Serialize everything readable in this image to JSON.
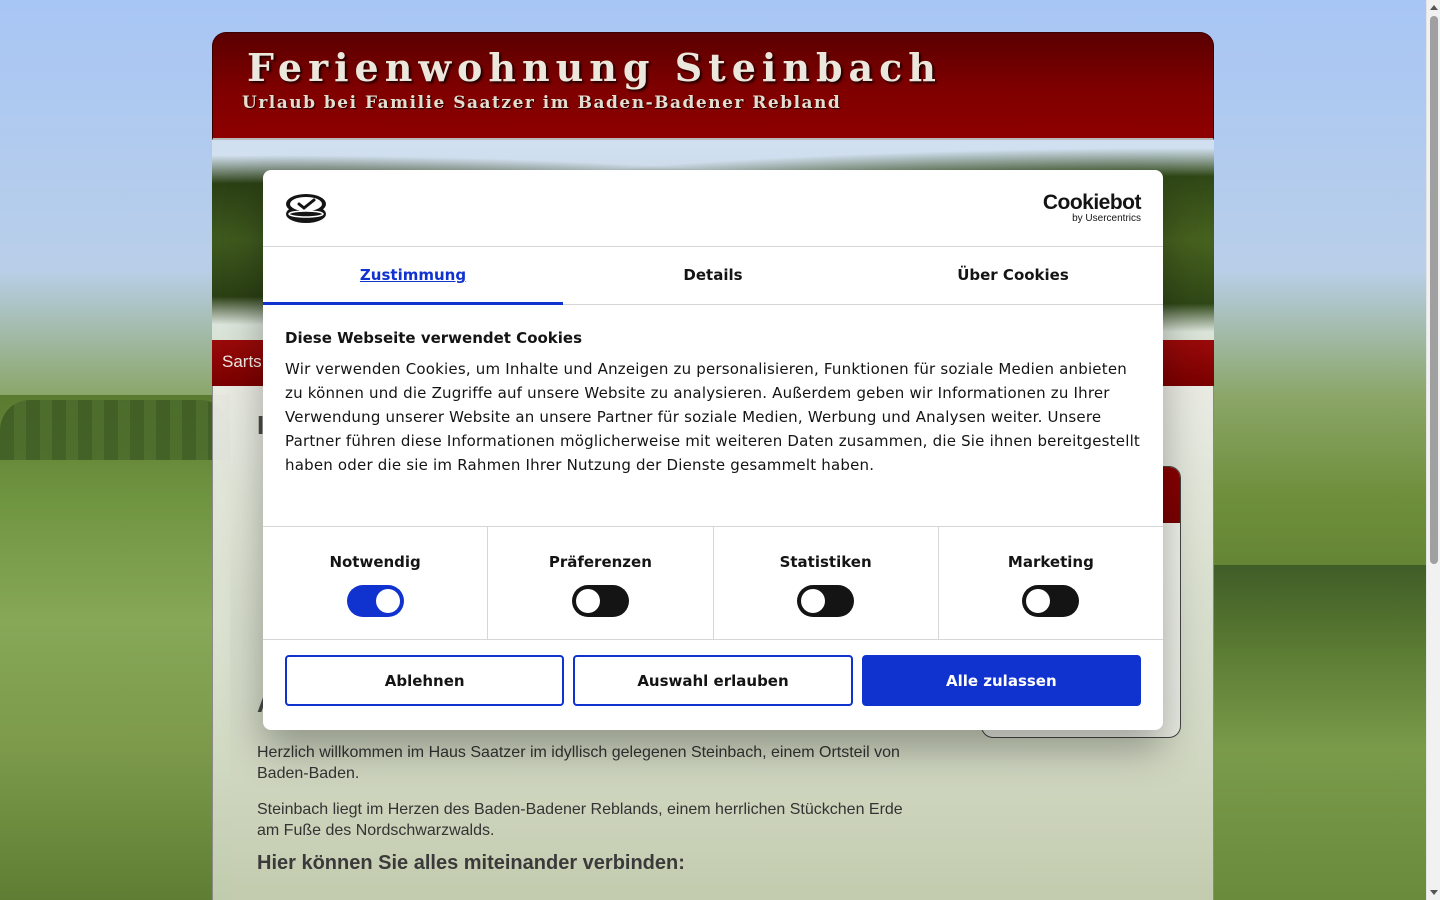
{
  "site": {
    "title": "Ferienwohnung Steinbach",
    "subtitle": "Urlaub bei Familie Saatzer im Baden-Badener Rebland",
    "nav_item": "Sarts",
    "heading_partial_1": "I",
    "heading_partial_2": "A",
    "para1": "Herzlich willkommen im Haus Saatzer im idyllisch gelegenen Steinbach, einem Ortsteil von Baden-Baden.",
    "para2": "Steinbach liegt im Herzen des Baden-Badener Reblands, einem herrlichen Stückchen Erde am Fuße des Nordschwarzwalds.",
    "subheading": "Hier können Sie alles miteinander verbinden:"
  },
  "cookie": {
    "brand_name": "Cookiebot",
    "brand_sub": "by Usercentrics",
    "tabs": [
      {
        "label": "Zustimmung",
        "active": true
      },
      {
        "label": "Details",
        "active": false
      },
      {
        "label": "Über Cookies",
        "active": false
      }
    ],
    "title": "Diese Webseite verwendet Cookies",
    "text": "Wir verwenden Cookies, um Inhalte und Anzeigen zu personalisieren, Funktionen für soziale Medien anbieten zu können und die Zugriffe auf unsere Website zu analysieren. Außerdem geben wir Informationen zu Ihrer Verwendung unserer Website an unsere Partner für soziale Medien, Werbung und Analysen weiter. Unsere Partner führen diese Informationen möglicherweise mit weiteren Daten zusammen, die Sie ihnen bereitgestellt haben oder die sie im Rahmen Ihrer Nutzung der Dienste gesammelt haben.",
    "toggles": [
      {
        "label": "Notwendig",
        "on": true
      },
      {
        "label": "Präferenzen",
        "on": false
      },
      {
        "label": "Statistiken",
        "on": false
      },
      {
        "label": "Marketing",
        "on": false
      }
    ],
    "buttons": {
      "decline": "Ablehnen",
      "allow_selection": "Auswahl erlauben",
      "allow_all": "Alle zulassen"
    },
    "accent_color": "#1032cf"
  }
}
